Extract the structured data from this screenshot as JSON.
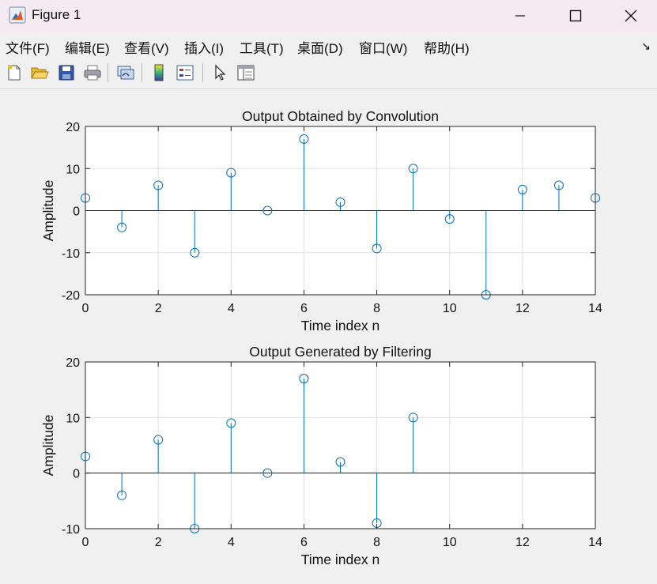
{
  "window": {
    "title": "Figure 1",
    "icon": "matlab-figure-icon"
  },
  "menu": [
    {
      "label": "文件(F)"
    },
    {
      "label": "编辑(E)"
    },
    {
      "label": "查看(V)"
    },
    {
      "label": "插入(I)"
    },
    {
      "label": "工具(T)"
    },
    {
      "label": "桌面(D)"
    },
    {
      "label": "窗口(W)"
    },
    {
      "label": "帮助(H)"
    }
  ],
  "toolbar": [
    "new-figure-icon",
    "open-folder-icon",
    "save-icon",
    "print-icon",
    "link-plot-icon",
    "colorbar-icon",
    "legend-icon",
    "pointer-icon",
    "property-editor-icon"
  ],
  "colors": {
    "stem": "#0072bd",
    "axis": "#262626",
    "grid": "#e0e0e0"
  },
  "chart_data": [
    {
      "type": "stem",
      "title": "Output Obtained by Convolution",
      "xlabel": "Time index n",
      "ylabel": "Amplitude",
      "xlim": [
        0,
        14
      ],
      "ylim": [
        -20,
        20
      ],
      "xticks": [
        0,
        2,
        4,
        6,
        8,
        10,
        12,
        14
      ],
      "yticks": [
        -20,
        -10,
        0,
        10,
        20
      ],
      "grid": true,
      "x": [
        0,
        1,
        2,
        3,
        4,
        5,
        6,
        7,
        8,
        9,
        10,
        11,
        12,
        13,
        14
      ],
      "y": [
        3,
        -4,
        6,
        -10,
        9,
        0,
        17,
        2,
        -9,
        10,
        -2,
        -20,
        5,
        6,
        3
      ]
    },
    {
      "type": "stem",
      "title": "Output Generated by Filtering",
      "xlabel": "Time index n",
      "ylabel": "Amplitude",
      "xlim": [
        0,
        14
      ],
      "ylim": [
        -10,
        20
      ],
      "xticks": [
        0,
        2,
        4,
        6,
        8,
        10,
        12,
        14
      ],
      "yticks": [
        -10,
        0,
        10,
        20
      ],
      "grid": true,
      "x": [
        0,
        1,
        2,
        3,
        4,
        5,
        6,
        7,
        8,
        9
      ],
      "y": [
        3,
        -4,
        6,
        -10,
        9,
        0,
        17,
        2,
        -9,
        10
      ]
    }
  ]
}
